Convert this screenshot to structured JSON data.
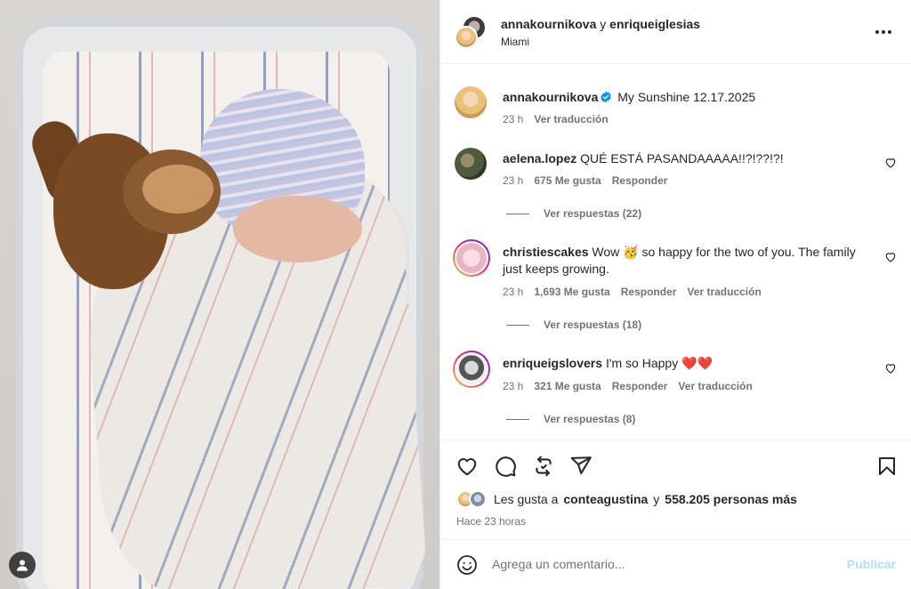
{
  "header": {
    "user1": "annakournikova",
    "conj": "y",
    "user2": "enriqueiglesias",
    "location": "Miami"
  },
  "caption": {
    "username": "annakournikova",
    "text": "My Sunshine 12.17.2025",
    "time": "23 h",
    "translate": "Ver traducción"
  },
  "comments": [
    {
      "username": "aelena.lopez",
      "text": "QUÉ ESTÁ PASANDAAAAA!!?!??!?!",
      "time": "23 h",
      "likes": "675 Me gusta",
      "reply": "Responder",
      "translate": "",
      "view_replies": "Ver respuestas (22)"
    },
    {
      "username": "christiescakes",
      "text": "Wow 🥳 so happy for the two of you. The family just keeps growing.",
      "time": "23 h",
      "likes": "1,693 Me gusta",
      "reply": "Responder",
      "translate": "Ver traducción",
      "view_replies": "Ver respuestas (18)"
    },
    {
      "username": "enriqueigslovers",
      "text": "I'm so Happy ❤️❤️",
      "time": "23 h",
      "likes": "321 Me gusta",
      "reply": "Responder",
      "translate": "Ver traducción",
      "view_replies": "Ver respuestas (8)"
    }
  ],
  "likes": {
    "prefix": "Les gusta a",
    "user": "conteagustina",
    "conj": "y",
    "count": "558.205 personas más"
  },
  "ago": "Hace 23 horas",
  "composer": {
    "placeholder": "Agrega un comentario...",
    "publish": "Publicar"
  },
  "colors": {
    "verified": "#0095f6",
    "publish_disabled": "#b3dbff",
    "secondary_text": "#737373"
  }
}
